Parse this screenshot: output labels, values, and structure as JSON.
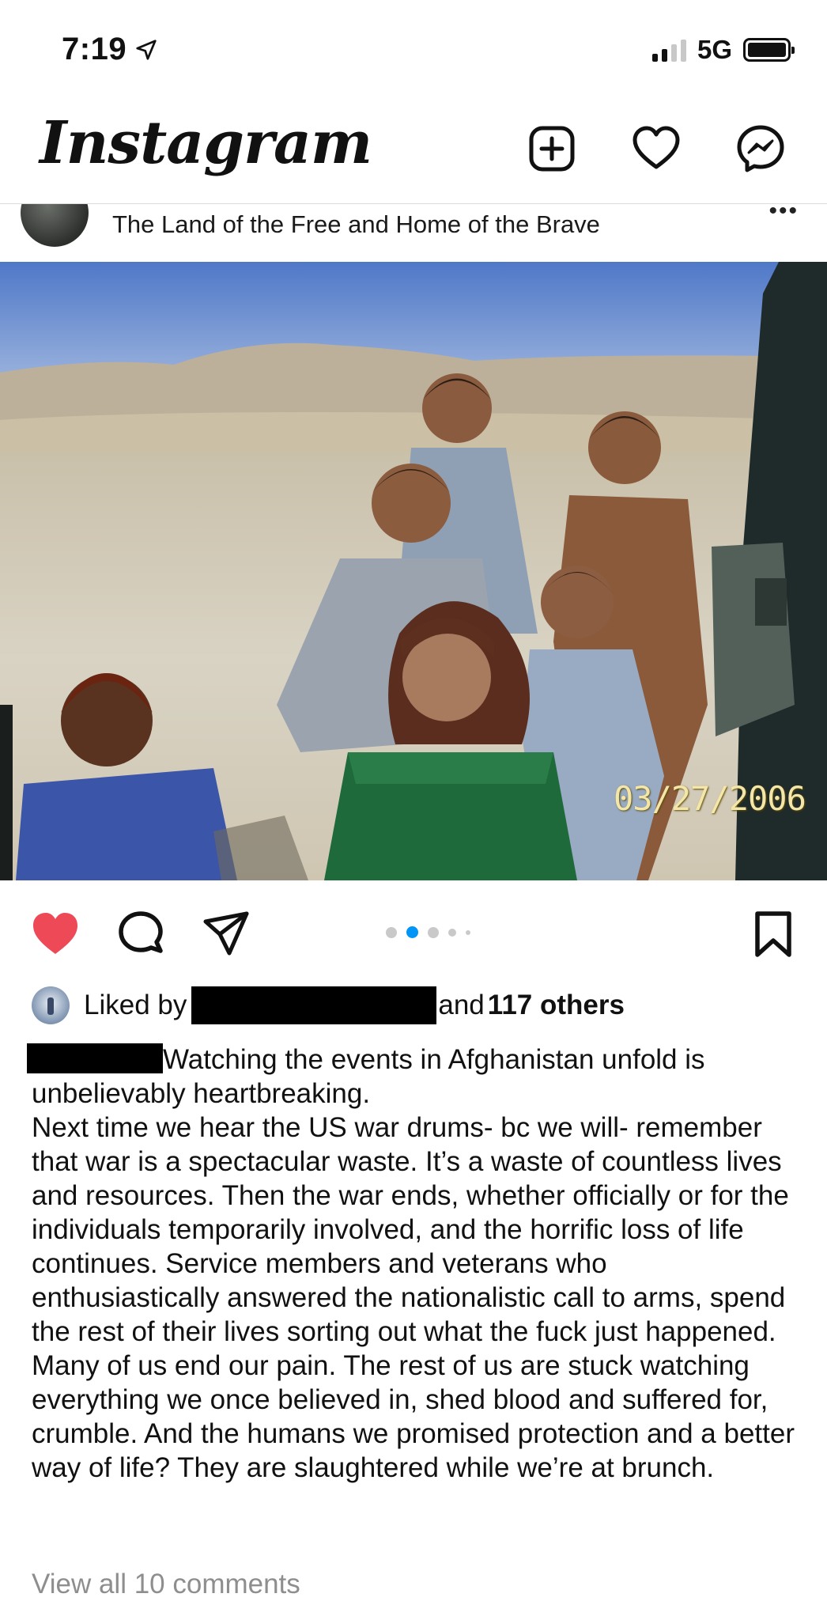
{
  "status_bar": {
    "time": "7:19",
    "network": "5G",
    "location_icon": "location-arrow-icon",
    "battery_icon": "battery-icon"
  },
  "header": {
    "app_name": "Instagram",
    "icons": [
      "new-post-icon",
      "heart-icon",
      "messenger-icon"
    ]
  },
  "post": {
    "location": "The Land of the Free and Home of the Brave",
    "photo": {
      "date_stamp": "03/27/2006"
    },
    "carousel": {
      "count": 5,
      "active_index": 1
    },
    "liked": true,
    "likes": {
      "prefix": "Liked by",
      "connector": "and",
      "others": "117 others"
    },
    "caption": {
      "first_line": "Watching the events in Afghanistan unfold is unbelievably heartbreaking.",
      "body": "Next time we hear the US war drums- bc we will- remember that war is a spectacular waste. It’s a waste of countless lives and resources. Then the war ends, whether officially or for the individuals temporarily involved, and the horrific loss of life continues. Service members and veterans who enthusiastically answered the nationalistic call to arms, spend the rest of their lives sorting out what the fuck just happened. Many of us end our pain. The rest of us are stuck watching everything we once believed in, shed blood and suffered for, crumble. And the humans we promised protection and a better way of life? They are slaughtered while we’re at brunch."
    },
    "comments_link": "View all 10 comments"
  },
  "colors": {
    "like_red": "#ed4956",
    "active_dot": "#0095f6",
    "muted_text": "#8e8e8e"
  }
}
